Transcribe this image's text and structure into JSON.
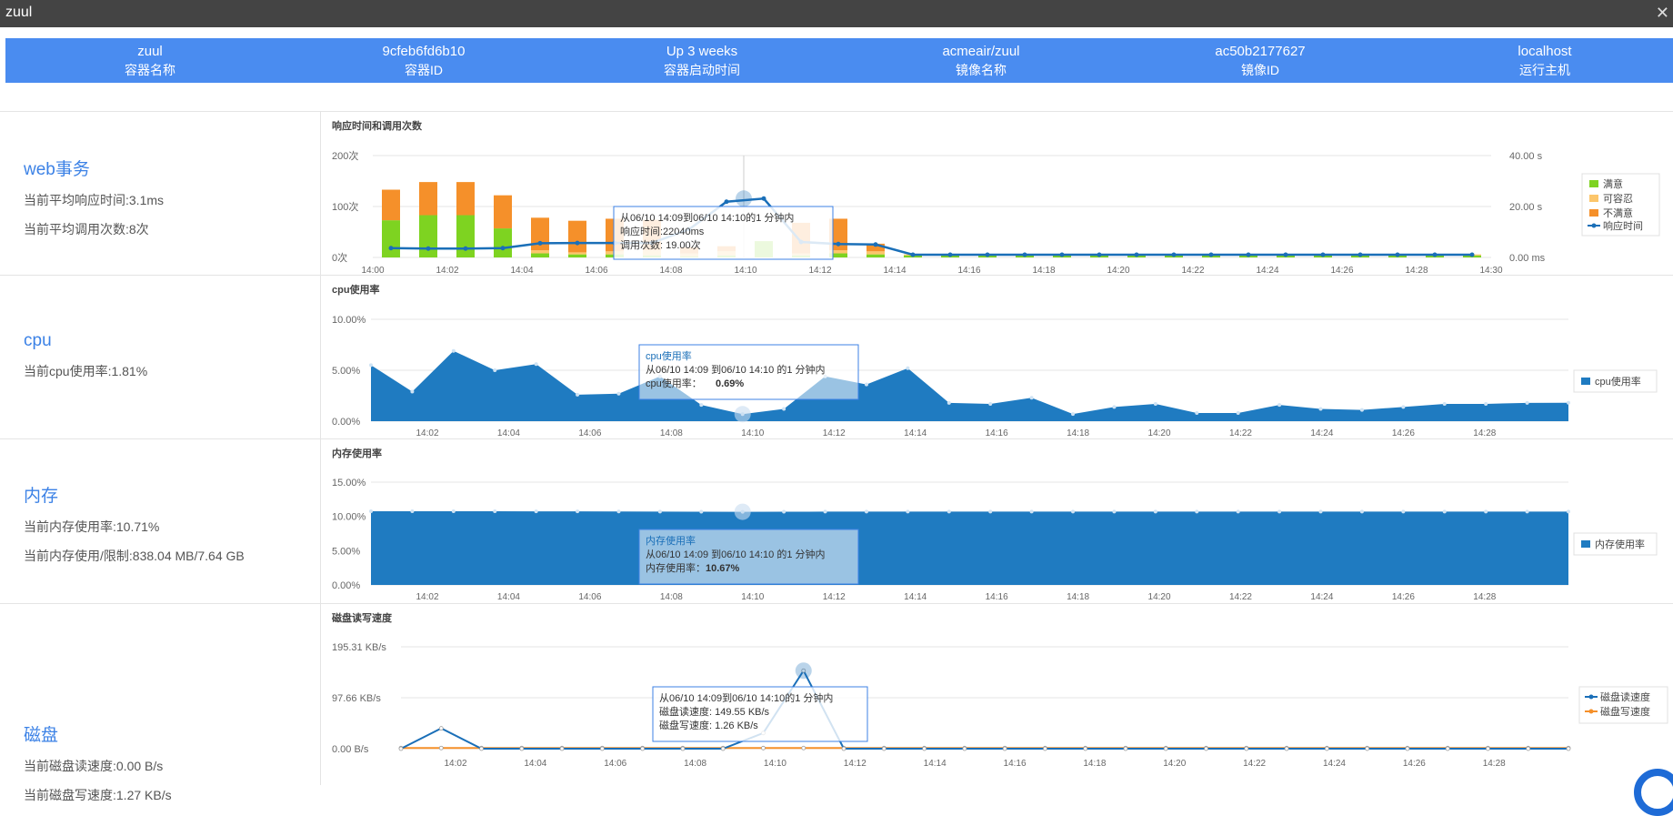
{
  "window": {
    "title": "zuul",
    "close_glyph": "✕"
  },
  "info": [
    {
      "value": "zuul",
      "label": "容器名称"
    },
    {
      "value": "9cfeb6fd6b10",
      "label": "容器ID"
    },
    {
      "value": "Up 3 weeks",
      "label": "容器启动时间"
    },
    {
      "value": "acmeair/zuul",
      "label": "镜像名称"
    },
    {
      "value": "ac50b2177627",
      "label": "镜像ID"
    },
    {
      "value": "localhost",
      "label": "运行主机"
    }
  ],
  "sections": {
    "web": {
      "title": "web事务",
      "lines": [
        "当前平均响应时间:3.1ms",
        "当前平均调用次数:8次"
      ]
    },
    "cpu": {
      "title": "cpu",
      "lines": [
        "当前cpu使用率:1.81%"
      ]
    },
    "mem": {
      "title": "内存",
      "lines": [
        "当前内存使用率:10.71%",
        "当前内存使用/限制:838.04 MB/7.64 GB"
      ]
    },
    "disk": {
      "title": "磁盘",
      "lines": [
        "当前磁盘读速度:0.00 B/s",
        "当前磁盘写速度:1.27 KB/s"
      ]
    }
  },
  "colors": {
    "accent": "#4a8cf0",
    "cpu": "#1f7bc1",
    "satisfied": "#7ed321",
    "tolerable": "#fcc66b",
    "unsatisfied": "#f5902a",
    "resp": "#1a6fb8",
    "read": "#1a6fb8",
    "write": "#f5902a"
  },
  "chart_data": [
    {
      "type": "bar+line",
      "title": "响应时间和调用次数",
      "x": [
        "14:00",
        "14:01",
        "14:02",
        "14:03",
        "14:04",
        "14:05",
        "14:06",
        "14:07",
        "14:08",
        "14:09",
        "14:10",
        "14:11",
        "14:12",
        "14:13",
        "14:14",
        "14:15",
        "14:16",
        "14:17",
        "14:18",
        "14:19",
        "14:20",
        "14:21",
        "14:22",
        "14:23",
        "14:24",
        "14:25",
        "14:26",
        "14:27",
        "14:28",
        "14:29"
      ],
      "x_ticks": [
        "14:00",
        "14:02",
        "14:04",
        "14:06",
        "14:08",
        "14:10",
        "14:12",
        "14:14",
        "14:16",
        "14:18",
        "14:20",
        "14:22",
        "14:24",
        "14:26",
        "14:28",
        "14:30"
      ],
      "y_ticks_left": [
        "0次",
        "100次",
        "200次"
      ],
      "y_ticks_right": [
        "0.00 ms",
        "20.00 s",
        "40.00 s"
      ],
      "ylim_left": [
        0,
        200
      ],
      "ylim_right": [
        0,
        40
      ],
      "series": [
        {
          "name": "满意",
          "values": [
            73,
            83,
            83,
            57,
            8,
            6,
            6,
            4,
            2,
            4,
            32,
            4,
            8,
            6,
            4,
            4,
            4,
            4,
            4,
            4,
            4,
            4,
            4,
            4,
            4,
            4,
            4,
            4,
            4,
            4
          ]
        },
        {
          "name": "可容忍",
          "values": [
            0,
            0,
            0,
            0,
            6,
            4,
            6,
            10,
            6,
            8,
            0,
            4,
            6,
            6,
            2,
            2,
            2,
            2,
            2,
            2,
            2,
            2,
            2,
            2,
            2,
            2,
            2,
            2,
            2,
            2
          ]
        },
        {
          "name": "不满意",
          "values": [
            60,
            65,
            65,
            65,
            64,
            62,
            64,
            60,
            12,
            10,
            0,
            60,
            62,
            15,
            0,
            0,
            0,
            0,
            0,
            0,
            0,
            0,
            0,
            0,
            0,
            0,
            0,
            0,
            0,
            0
          ]
        },
        {
          "name": "响应时间",
          "values": [
            2.6,
            2.4,
            2.4,
            2.6,
            4.5,
            4.6,
            4.6,
            4.6,
            10.0,
            20.8,
            22.04,
            5.0,
            4.2,
            4.0,
            0,
            0,
            0,
            0,
            0,
            0,
            0,
            0,
            0,
            0,
            0,
            0,
            0,
            0,
            0,
            0
          ]
        }
      ],
      "legend": [
        "满意",
        "可容忍",
        "不满意",
        "响应时间"
      ],
      "tooltip": [
        "从06/10 14:09到06/10 14:10的1 分钟内",
        "响应时间:22040ms",
        "调用次数: 19.00次"
      ]
    },
    {
      "type": "area",
      "title": "cpu使用率",
      "series": [
        {
          "name": "cpu使用率",
          "values": [
            5.5,
            2.9,
            6.9,
            5.0,
            5.6,
            2.6,
            2.7,
            4.4,
            1.6,
            0.69,
            1.2,
            4.4,
            3.6,
            5.2,
            1.8,
            1.7,
            2.3,
            0.7,
            1.4,
            1.7,
            0.8,
            0.8,
            1.6,
            1.2,
            1.1,
            1.4,
            1.7,
            1.7,
            1.8,
            1.81
          ]
        }
      ],
      "x_ticks": [
        "14:02",
        "14:04",
        "14:06",
        "14:08",
        "14:10",
        "14:12",
        "14:14",
        "14:16",
        "14:18",
        "14:20",
        "14:22",
        "14:24",
        "14:26",
        "14:28"
      ],
      "y_ticks": [
        "0.00%",
        "5.00%",
        "10.00%"
      ],
      "ylim": [
        0,
        10
      ],
      "legend": [
        "cpu使用率"
      ],
      "tooltip": {
        "title": "cpu使用率",
        "line1": "从06/10 14:09 到06/10 14:10 的1 分钟内",
        "label": "cpu使用率：",
        "value": "0.69%"
      }
    },
    {
      "type": "area",
      "title": "内存使用率",
      "series": [
        {
          "name": "内存使用率",
          "values": [
            10.75,
            10.75,
            10.75,
            10.75,
            10.74,
            10.73,
            10.72,
            10.7,
            10.69,
            10.67,
            10.68,
            10.7,
            10.7,
            10.7,
            10.7,
            10.7,
            10.7,
            10.7,
            10.7,
            10.7,
            10.7,
            10.7,
            10.7,
            10.7,
            10.7,
            10.7,
            10.7,
            10.7,
            10.71,
            10.71
          ]
        }
      ],
      "x_ticks": [
        "14:02",
        "14:04",
        "14:06",
        "14:08",
        "14:10",
        "14:12",
        "14:14",
        "14:16",
        "14:18",
        "14:20",
        "14:22",
        "14:24",
        "14:26",
        "14:28"
      ],
      "y_ticks": [
        "0.00%",
        "5.00%",
        "10.00%",
        "15.00%"
      ],
      "ylim": [
        0,
        15
      ],
      "legend": [
        "内存使用率"
      ],
      "tooltip": {
        "title": "内存使用率",
        "line1": "从06/10 14:09 到06/10 14:10 的1 分钟内",
        "label": "内存使用率：",
        "value": "10.67%"
      }
    },
    {
      "type": "line",
      "title": "磁盘读写速度",
      "series": [
        {
          "name": "磁盘读速度",
          "values": [
            0,
            39,
            0,
            0,
            0,
            0,
            0,
            0,
            0,
            30,
            149.55,
            0,
            0,
            0,
            0,
            0,
            0,
            0,
            0,
            0,
            0,
            0,
            0,
            0,
            0,
            0,
            0,
            0,
            0,
            0
          ]
        },
        {
          "name": "磁盘写速度",
          "values": [
            1.2,
            1.3,
            1.2,
            1.3,
            1.2,
            1.3,
            1.2,
            1.2,
            1.3,
            1.2,
            1.26,
            1.2,
            1.3,
            1.2,
            1.2,
            1.3,
            1.2,
            1.2,
            1.3,
            1.2,
            1.2,
            1.3,
            1.2,
            1.2,
            1.3,
            1.2,
            1.2,
            1.3,
            1.2,
            1.27
          ]
        }
      ],
      "x_ticks": [
        "14:02",
        "14:04",
        "14:06",
        "14:08",
        "14:10",
        "14:12",
        "14:14",
        "14:16",
        "14:18",
        "14:20",
        "14:22",
        "14:24",
        "14:26",
        "14:28"
      ],
      "y_ticks": [
        "0.00 B/s",
        "97.66 KB/s",
        "195.31 KB/s"
      ],
      "ylim": [
        0,
        195.31
      ],
      "legend": [
        "磁盘读速度",
        "磁盘写速度"
      ],
      "tooltip": [
        "从06/10 14:09到06/10 14:10的1 分钟内",
        "磁盘读速度: 149.55 KB/s",
        "磁盘写速度: 1.26 KB/s"
      ]
    }
  ]
}
